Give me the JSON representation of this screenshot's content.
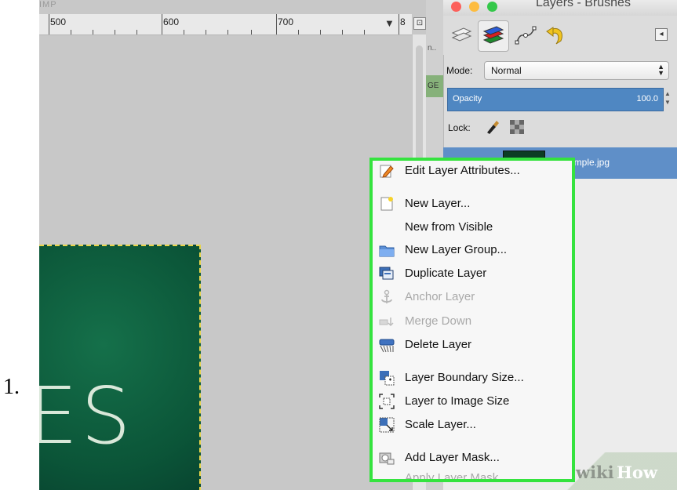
{
  "list_marker": "1.",
  "canvas": {
    "title_fragment": "IMP",
    "ruler_labels": [
      "500",
      "600",
      "700",
      "8"
    ]
  },
  "layers_dock": {
    "title": "Layers - Brushes",
    "tabs": [
      {
        "name": "layers-tab-icon"
      },
      {
        "name": "channels-tab-icon"
      },
      {
        "name": "paths-tab-icon"
      },
      {
        "name": "undo-history-tab-icon"
      }
    ],
    "side_fragments": [
      "n..",
      "GE"
    ],
    "mode_label": "Mode:",
    "mode_value": "Normal",
    "opacity_label": "Opacity",
    "opacity_value": "100.0",
    "lock_label": "Lock:",
    "layer_name": "ample.jpg"
  },
  "context_menu": {
    "items": [
      {
        "label": "Edit Layer Attributes...",
        "icon": "edit-icon",
        "disabled": false
      },
      {
        "label": "New Layer...",
        "icon": "new-layer-icon",
        "disabled": false
      },
      {
        "label": "New from Visible",
        "icon": "",
        "disabled": false
      },
      {
        "label": "New Layer Group...",
        "icon": "folder-icon",
        "disabled": false
      },
      {
        "label": "Duplicate Layer",
        "icon": "duplicate-icon",
        "disabled": false
      },
      {
        "label": "Anchor Layer",
        "icon": "anchor-icon",
        "disabled": true
      },
      {
        "label": "Merge Down",
        "icon": "merge-down-icon",
        "disabled": true
      },
      {
        "label": "Delete Layer",
        "icon": "delete-icon",
        "disabled": false
      },
      {
        "label": "Layer Boundary Size...",
        "icon": "boundary-size-icon",
        "disabled": false
      },
      {
        "label": "Layer to Image Size",
        "icon": "layer-to-image-icon",
        "disabled": false
      },
      {
        "label": "Scale Layer...",
        "icon": "scale-icon",
        "disabled": false
      },
      {
        "label": "Add Layer Mask...",
        "icon": "mask-icon",
        "disabled": false
      },
      {
        "label": "Apply Layer Mask",
        "icon": "",
        "disabled": true
      }
    ]
  },
  "watermark": {
    "part1": "wiki",
    "part2": "How"
  },
  "image_text": "ES",
  "colors": {
    "menu_highlight_border": "#35e33f",
    "selection_blue": "#4f87c2",
    "image_green": "#0b5538"
  }
}
